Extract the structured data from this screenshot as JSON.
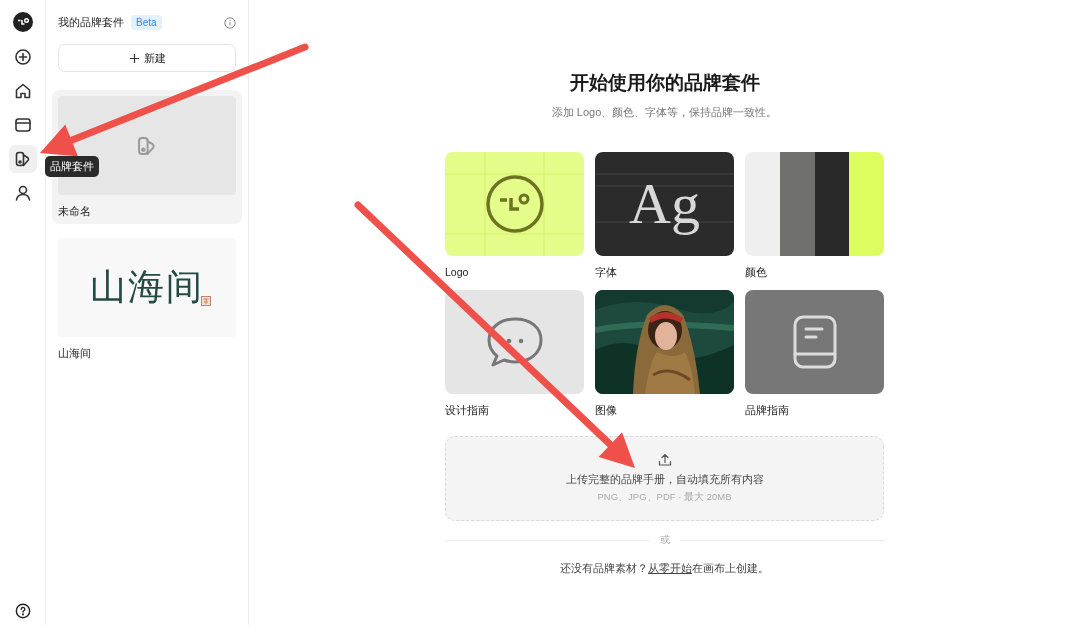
{
  "rail": {
    "items": [
      {
        "selected": false
      },
      {
        "selected": false
      },
      {
        "selected": false
      },
      {
        "selected": true
      },
      {
        "selected": false
      }
    ],
    "tooltip": "品牌套件"
  },
  "panel": {
    "title": "我的品牌套件",
    "badge": "Beta",
    "new_button": "新建",
    "kits": [
      {
        "name": "未命名",
        "kind": "empty",
        "selected": true
      },
      {
        "name": "山海间",
        "kind": "wordmark",
        "wordmark": "山海间",
        "selected": false
      }
    ]
  },
  "main": {
    "title": "开始使用你的品牌套件",
    "subtitle": "添加 Logo、颜色、字体等，保持品牌一致性。",
    "cards": [
      {
        "label": "Logo",
        "kind": "logo"
      },
      {
        "label": "字体",
        "kind": "type",
        "sample": "Ag"
      },
      {
        "label": "颜色",
        "kind": "colors",
        "swatches": [
          {
            "color": "#efefef"
          },
          {
            "color": "#70706c"
          },
          {
            "color": "#282828"
          },
          {
            "color": "#ddfc5e"
          }
        ]
      },
      {
        "label": "设计指南",
        "kind": "chat"
      },
      {
        "label": "图像",
        "kind": "picture"
      },
      {
        "label": "品牌指南",
        "kind": "book"
      }
    ],
    "upload": {
      "text": "上传完整的品牌手册，自动填充所有内容",
      "hint": "PNG、JPG、PDF · 最大 20MB"
    },
    "divider": "或",
    "footer": {
      "before": "还没有品牌素材？",
      "link": "从零开始",
      "after": "在画布上创建。"
    }
  },
  "annotations": [
    {
      "kind": "arrow"
    },
    {
      "kind": "arrow"
    }
  ]
}
